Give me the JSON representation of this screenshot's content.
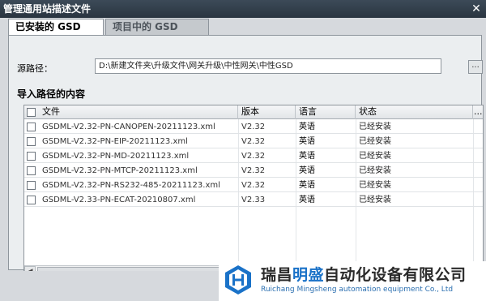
{
  "window": {
    "title": "管理通用站描述文件",
    "close_label": "✕"
  },
  "tabs": [
    {
      "label": "已安装的 GSD",
      "active": true
    },
    {
      "label": "项目中的 GSD",
      "active": false
    }
  ],
  "source": {
    "label": "源路径：",
    "path": "D:\\新建文件夹\\升级文件\\网关升级\\中性网关\\中性GSD",
    "browse_label": "..."
  },
  "section_title": "导入路径的内容",
  "table": {
    "columns": [
      "文件",
      "版本",
      "语言",
      "状态",
      "..."
    ],
    "rows": [
      {
        "file": "GSDML-V2.32-PN-CANOPEN-20211123.xml",
        "version": "V2.32",
        "language": "英语",
        "status": "已经安装"
      },
      {
        "file": "GSDML-V2.32-PN-EIP-20211123.xml",
        "version": "V2.32",
        "language": "英语",
        "status": "已经安装"
      },
      {
        "file": "GSDML-V2.32-PN-MD-20211123.xml",
        "version": "V2.32",
        "language": "英语",
        "status": "已经安装"
      },
      {
        "file": "GSDML-V2.32-PN-MTCP-20211123.xml",
        "version": "V2.32",
        "language": "英语",
        "status": "已经安装"
      },
      {
        "file": "GSDML-V2.32-PN-RS232-485-20211123.xml",
        "version": "V2.32",
        "language": "英语",
        "status": "已经安装"
      },
      {
        "file": "GSDML-V2.33-PN-ECAT-20210807.xml",
        "version": "V2.33",
        "language": "英语",
        "status": "已经安装"
      }
    ],
    "scroll_left": "◀",
    "scroll_right": "▶",
    "scroll_thumb": "III"
  },
  "brand": {
    "name_part1": "瑞昌",
    "name_highlight": "明盛",
    "name_part2": "自动化设备有限公司",
    "subtitle": "Ruichang Mingsheng automation equipment Co., Ltd",
    "colors": {
      "primary": "#1a72c8",
      "text": "#2b2b2b"
    },
    "logo_icon": "hexagon-logo-icon"
  }
}
